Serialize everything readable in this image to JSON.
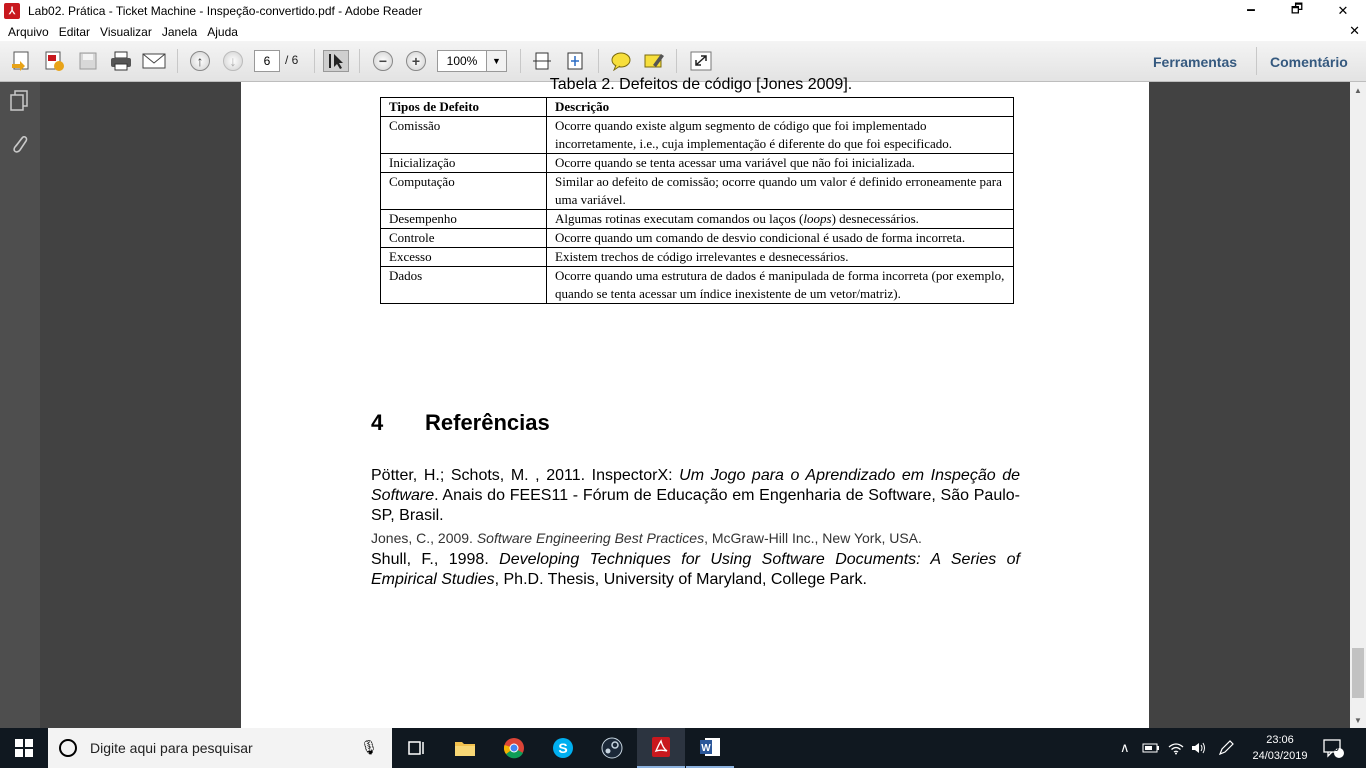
{
  "window": {
    "title": "Lab02. Prática - Ticket Machine - Inspeção-convertido.pdf - Adobe Reader",
    "minimize": "🗕",
    "restore": "🗗",
    "close": "✕"
  },
  "menu": {
    "items": [
      "Arquivo",
      "Editar",
      "Visualizar",
      "Janela",
      "Ajuda"
    ],
    "close_doc": "✕"
  },
  "toolbar": {
    "page_current": "6",
    "page_total": "/ 6",
    "zoom": "100%",
    "ferramentas": "Ferramentas",
    "comentario": "Comentário"
  },
  "document": {
    "table_caption": "Tabela 2. Defeitos de código [Jones 2009].",
    "table_headers": [
      "Tipos de Defeito",
      "Descrição"
    ],
    "table_rows": [
      [
        "Comissão",
        "Ocorre quando existe algum segmento de código que foi implementado incorretamente, i.e., cuja implementação é diferente do que foi especificado."
      ],
      [
        "Inicialização",
        "Ocorre quando se tenta acessar uma variável que não foi inicializada."
      ],
      [
        "Computação",
        "Similar ao defeito de comissão; ocorre quando um valor é definido erroneamente para uma variável."
      ],
      [
        "Desempenho",
        "Algumas rotinas executam comandos ou laços (loops) desnecessários."
      ],
      [
        "Controle",
        "Ocorre quando um comando de desvio condicional é usado de forma incorreta."
      ],
      [
        "Excesso",
        "Existem trechos de código irrelevantes e desnecessários."
      ],
      [
        "Dados",
        "Ocorre quando uma estrutura de dados é manipulada de forma incorreta (por exemplo, quando se tenta acessar um índice inexistente de um vetor/matriz)."
      ]
    ],
    "section_number": "4",
    "section_title": "Referências",
    "refs": [
      {
        "pre": "Pötter, H.; Schots, M. , 2011. InspectorX: ",
        "em": "Um Jogo para o Aprendizado em Inspeção de Software",
        "post": ". Anais do FEES11 - Fórum de Educação em Engenharia de Software, São Paulo-SP, Brasil."
      },
      {
        "pre": "Jones, C., 2009. ",
        "em": "Software Engineering Best Practices",
        "post": ", McGraw-Hill Inc., New York, USA."
      },
      {
        "pre": "Shull, F., 1998. ",
        "em": "Developing Techniques for Using Software Documents: A Series of Empirical Studies",
        "post": ", Ph.D. Thesis, University of Maryland, College Park."
      }
    ]
  },
  "taskbar": {
    "search_placeholder": "Digite aqui para pesquisar",
    "time": "23:06",
    "date": "24/03/2019",
    "notification_count": "9"
  }
}
